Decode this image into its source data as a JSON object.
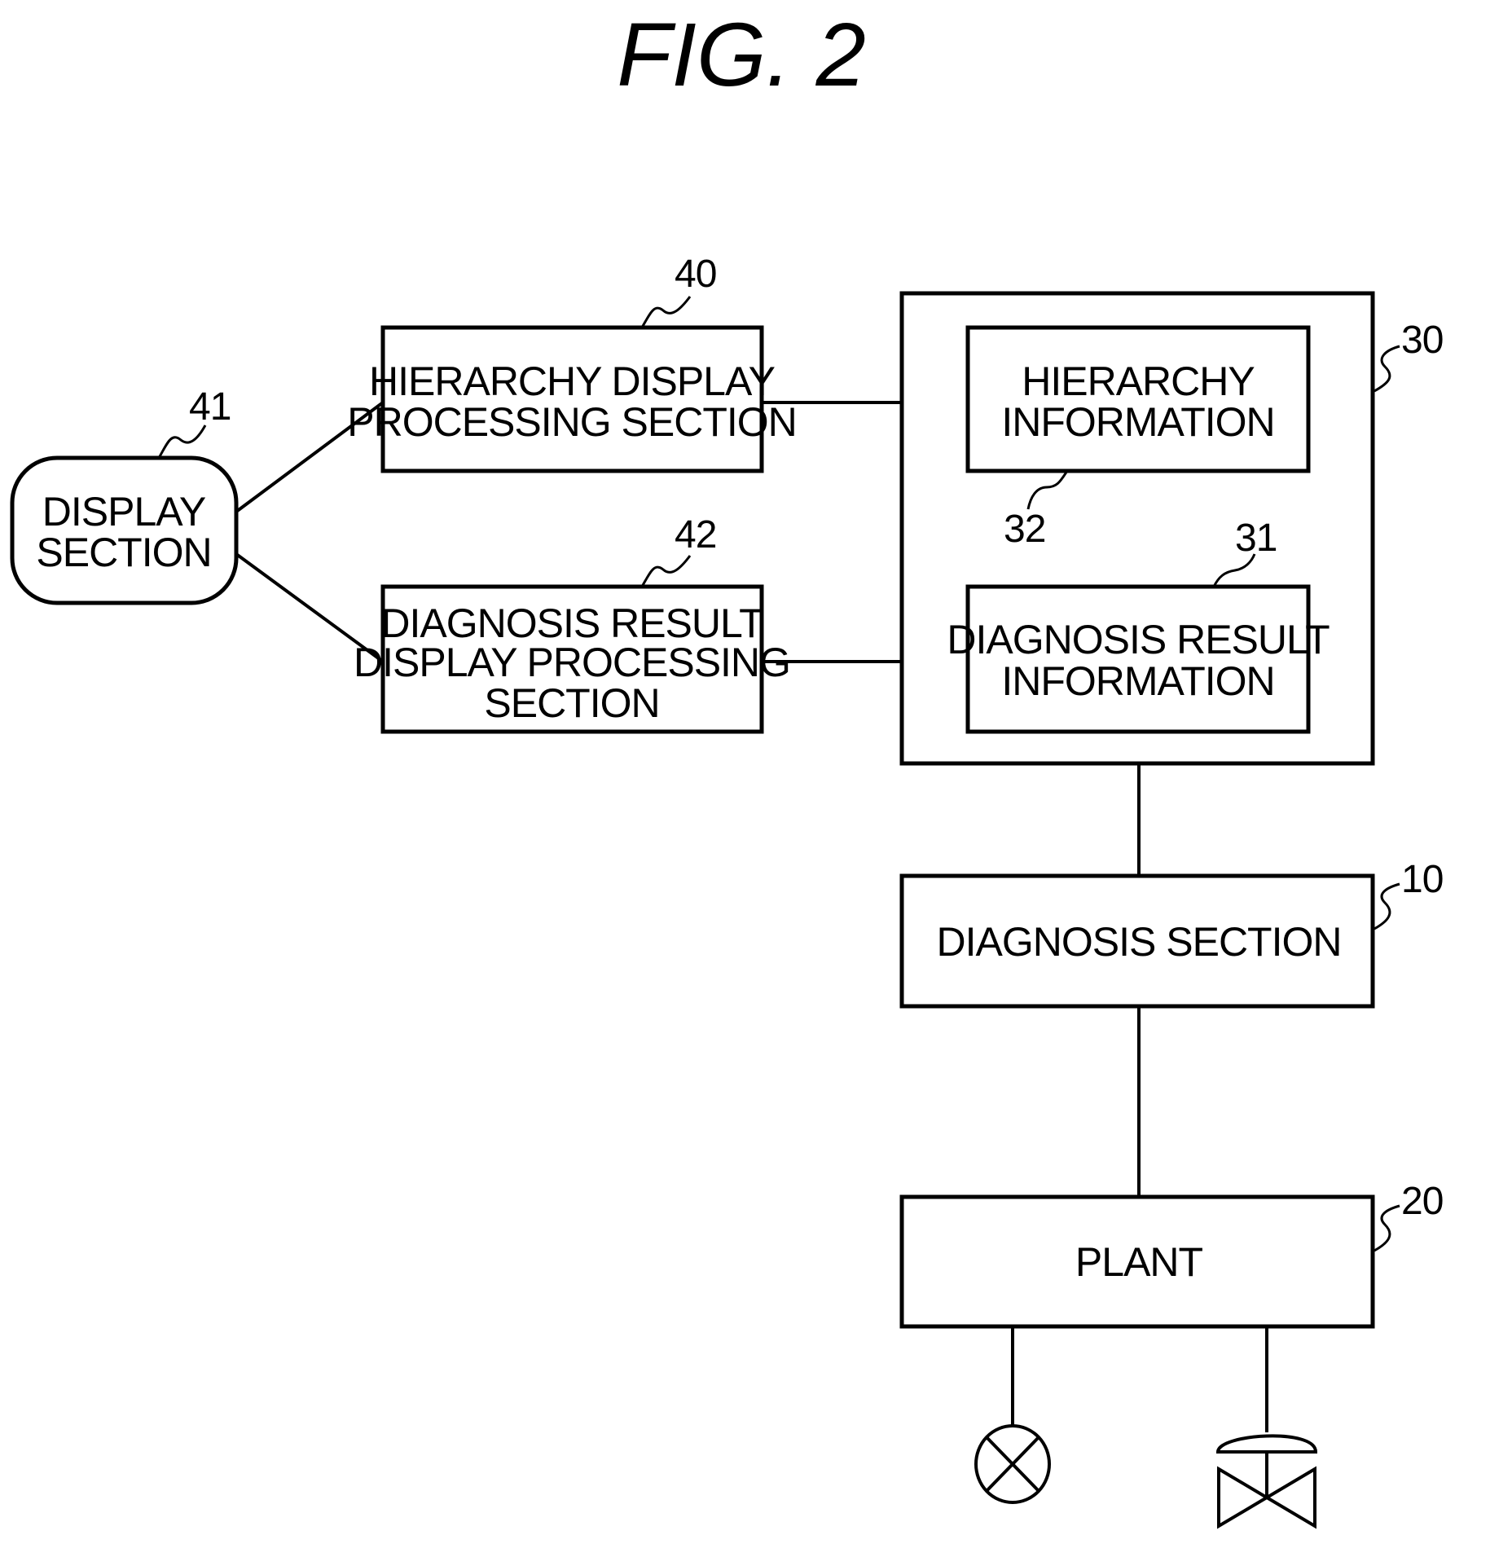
{
  "figure": {
    "title": "FIG.  2"
  },
  "blocks": {
    "display_section": {
      "ref": "41",
      "lines": [
        "DISPLAY",
        "SECTION"
      ]
    },
    "hierarchy_display": {
      "ref": "40",
      "lines": [
        "HIERARCHY DISPLAY",
        "PROCESSING SECTION"
      ]
    },
    "diagnosis_display": {
      "ref": "42",
      "lines": [
        "DIAGNOSIS RESULT",
        "DISPLAY PROCESSING",
        "SECTION"
      ]
    },
    "storage": {
      "ref": "30"
    },
    "hierarchy_info": {
      "ref": "32",
      "lines": [
        "HIERARCHY",
        "INFORMATION"
      ]
    },
    "diagnosis_info": {
      "ref": "31",
      "lines": [
        "DIAGNOSIS RESULT",
        "INFORMATION"
      ]
    },
    "diagnosis_section": {
      "ref": "10",
      "lines": [
        "DIAGNOSIS SECTION"
      ]
    },
    "plant": {
      "ref": "20",
      "lines": [
        "PLANT"
      ]
    }
  },
  "plant_devices": [
    {
      "type": "sensor",
      "icon": "sensor-x-circle-icon"
    },
    {
      "type": "valve",
      "icon": "control-valve-icon"
    }
  ]
}
